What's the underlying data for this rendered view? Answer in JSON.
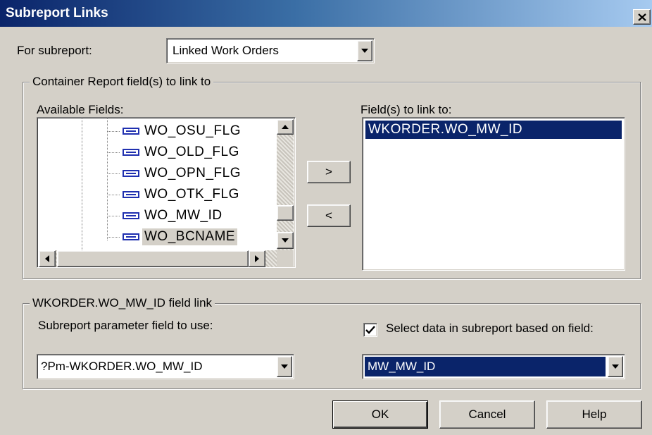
{
  "window": {
    "title": "Subreport Links",
    "close_glyph": "✕"
  },
  "subreport": {
    "label": "For subreport:",
    "value": "Linked Work Orders"
  },
  "container_group": {
    "legend": "Container Report field(s) to link to",
    "available_label": "Available Fields:",
    "available_fields": [
      "WO_OSU_FLG",
      "WO_OLD_FLG",
      "WO_OPN_FLG",
      "WO_OTK_FLG",
      "WO_MW_ID",
      "WO_BCNAME"
    ],
    "linked_label": "Field(s) to link to:",
    "linked_fields": [
      "WKORDER.WO_MW_ID"
    ],
    "add_button": ">",
    "remove_button": "<"
  },
  "link_group": {
    "legend": "WKORDER.WO_MW_ID field link",
    "param_label": "Subreport parameter field to use:",
    "param_value": "?Pm-WKORDER.WO_MW_ID",
    "select_data_checked": true,
    "select_data_label": "Select data in subreport based on field:",
    "field_value": "MW_MW_ID"
  },
  "buttons": {
    "ok": "OK",
    "cancel": "Cancel",
    "help": "Help"
  },
  "colors": {
    "face": "#d4d0c8",
    "selection": "#0a246a",
    "title_start": "#0a246a",
    "title_end": "#a6caf0"
  },
  "icons": [
    "close-icon",
    "chevron-down-icon",
    "field-icon",
    "checkmark-icon"
  ]
}
